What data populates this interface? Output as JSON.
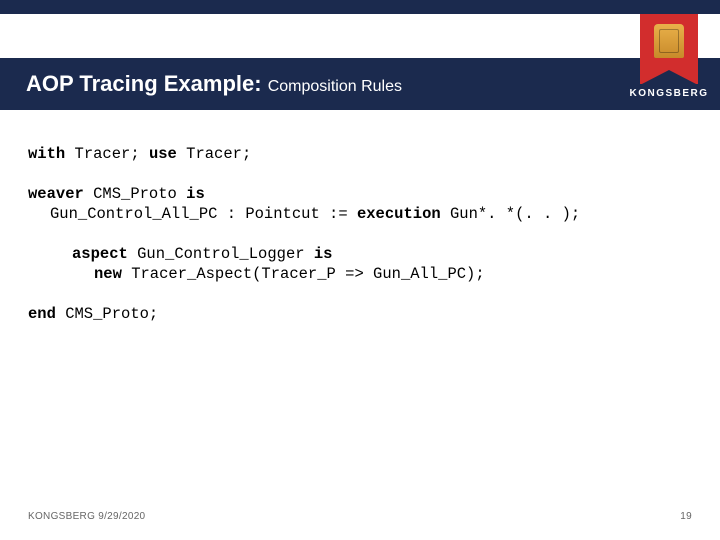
{
  "header": {
    "title_main": "AOP Tracing Example:",
    "title_sub": "Composition Rules",
    "brand": "KONGSBERG"
  },
  "code": {
    "l1_a": "with",
    "l1_b": " Tracer; ",
    "l1_c": "use",
    "l1_d": " Tracer;",
    "l2_a": "weaver",
    "l2_b": " CMS_Proto ",
    "l2_c": "is",
    "l3": "Gun_Control_All_PC : Pointcut := ",
    "l3_b": "execution",
    "l3_c": " Gun*. *(. . );",
    "l4_a": "aspect",
    "l4_b": " Gun_Control_Logger ",
    "l4_c": "is",
    "l5_a": "new",
    "l5_b": " Tracer_Aspect(Tracer_P => Gun_All_PC);",
    "l6_a": "end",
    "l6_b": " CMS_Proto;"
  },
  "footer": {
    "left": "KONGSBERG 9/29/2020",
    "right": "19"
  }
}
